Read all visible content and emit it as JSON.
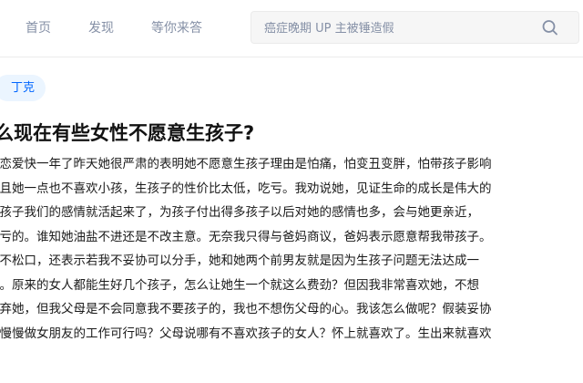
{
  "nav": {
    "items": [
      "首页",
      "发现",
      "等你来答"
    ]
  },
  "search": {
    "placeholder": "癌症晚期 UP 主被锤造假"
  },
  "question": {
    "topic": "丁克",
    "title": "么现在有些女性不愿意生孩子?",
    "body_lines": [
      "友恋爱快一年了昨天她很严肃的表明她不愿意生孩子理由是怕痛，怕变丑变胖，怕带孩子影响",
      "并且她一点也不喜欢小孩，生孩子的性价比太低，吃亏。我劝说她，见证生命的成长是伟大的",
      "了孩子我们的感情就活起来了，为孩子付出得多孩子以后对她的感情也多，会与她更亲近，",
      "吃亏的。谁知她油盐不进还是不改主意。无奈我只得与爸妈商议，爸妈表示愿意帮我带孩子。",
      "是不松口，还表示若我不妥协可以分手，她和她两个前男友就是因为生孩子问题无法达成一",
      "的。原来的女人都能生好几个孩子，怎么让她生一个就这么费劲？但因我非常喜欢她，不想",
      "放弃她，但我父母是不会同意我不要孩子的，我也不想伤父母的心。我该怎么做呢？假装妥协",
      "后慢慢做女朋友的工作可行吗？父母说哪有不喜欢孩子的女人？怀上就喜欢了。生出来就喜欢"
    ]
  },
  "colors": {
    "accent": "#0066ff",
    "nav_text": "#8590a6"
  }
}
